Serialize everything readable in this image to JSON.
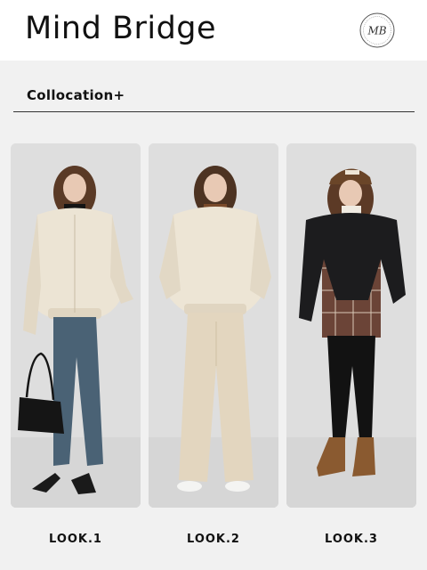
{
  "header": {
    "brand": "Mind Bridge",
    "logo_monogram": "MB",
    "logo_icon": "brand-seal-icon"
  },
  "section": {
    "title": "Collocation+"
  },
  "looks": [
    {
      "label": "LOOK.1",
      "image": "cream puffer jacket, black turtleneck, blue jeans, black handbag"
    },
    {
      "label": "LOOK.2",
      "image": "cream puffer jacket, brown turtleneck, beige wide trousers"
    },
    {
      "label": "LOOK.3",
      "image": "black puffer jacket, plaid shirt, black leggings, tan boots, brown cap"
    }
  ],
  "colors": {
    "header_bg": "#ffffff",
    "page_bg": "#f1f1f1",
    "card_bg": "#dcdcdc",
    "text": "#111111"
  }
}
